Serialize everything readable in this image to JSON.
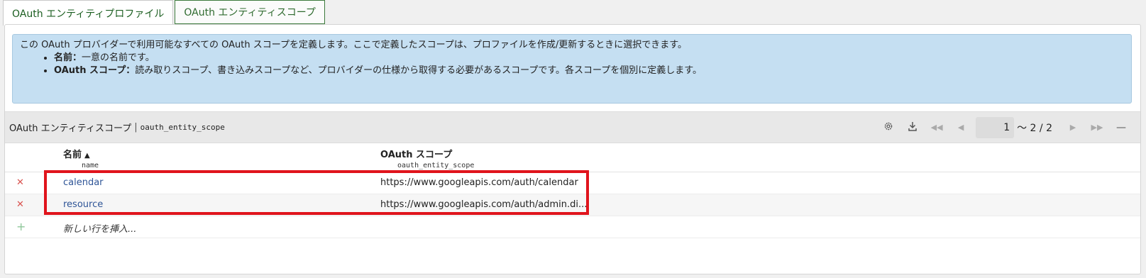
{
  "tabs": [
    {
      "label": "OAuth エンティティプロファイル"
    },
    {
      "label": "OAuth エンティティスコープ"
    }
  ],
  "info": {
    "intro": "この OAuth プロバイダーで利用可能なすべての OAuth スコープを定義します。ここで定義したスコープは、プロファイルを作成/更新するときに選択できます。",
    "items": [
      {
        "term": "名前：",
        "desc": "一意の名前です。"
      },
      {
        "term": "OAuth スコープ：",
        "desc": "読み取りスコープ、書き込みスコープなど、プロバイダーの仕様から取得する必要があるスコープです。各スコープを個別に定義します。"
      }
    ]
  },
  "toolbar": {
    "title": "OAuth エンティティスコープ",
    "separator": "|",
    "table_name": "oauth_entity_scope",
    "page_current": "1",
    "page_range": "～ 2 / 2",
    "icons": [
      "gear-icon",
      "download-icon",
      "first-page-icon",
      "prev-page-icon",
      "next-page-icon",
      "last-page-icon",
      "collapse-icon"
    ]
  },
  "columns": [
    {
      "label": "名前",
      "field": "name",
      "sort": "▲"
    },
    {
      "label": "OAuth スコープ",
      "field": "oauth_entity_scope"
    }
  ],
  "rows": [
    {
      "name": "calendar",
      "scope": "https://www.googleapis.com/auth/calendar"
    },
    {
      "name": "resource",
      "scope": "https://www.googleapis.com/auth/admin.di..."
    }
  ],
  "new_row_label": "新しい行を挿入...",
  "colors": {
    "accent": "#2e7d32",
    "info_bg": "#c5dff2",
    "link": "#2f5597",
    "delete": "#d9534f",
    "highlight": "#e0141c"
  }
}
